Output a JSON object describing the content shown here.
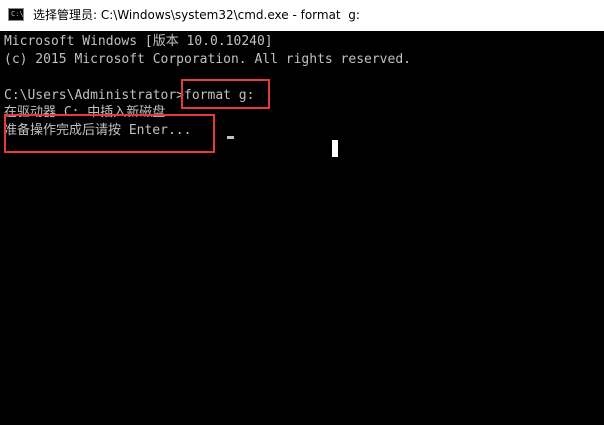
{
  "window": {
    "title": "选择管理员: C:\\Windows\\system32\\cmd.exe - format  g:",
    "icon": "console-icon",
    "icon_text": "C:\\"
  },
  "console": {
    "lines": [
      "Microsoft Windows [版本 10.0.10240]",
      "(c) 2015 Microsoft Corporation. All rights reserved.",
      "",
      "C:\\Users\\Administrator>format g:",
      "在驱动器 C: 中插入新磁盘",
      "准备操作完成后请按 Enter..."
    ]
  },
  "colors": {
    "console_bg": "#000000",
    "console_text": "#c0c0c0",
    "highlight": "#e53a3a"
  }
}
